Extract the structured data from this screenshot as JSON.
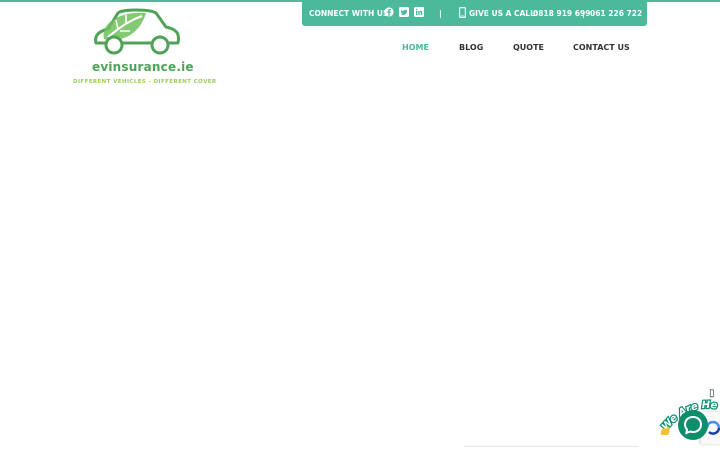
{
  "brand": {
    "name": "evinsurance.ie",
    "tagline": "DIFFERENT VEHICLES - DIFFERENT COVER",
    "primary_color": "#4bb99a",
    "logo_green": "#4fa356",
    "logo_lime": "#9ccb55"
  },
  "topbar": {
    "connect_label": "CONNECT WITH US:",
    "social_icons": [
      "facebook-icon",
      "twitter-icon",
      "linkedin-icon"
    ],
    "separator": "|",
    "call_label": "GIVE US A CALL:",
    "phone_1": "0818 919 699",
    "phone_separator": "|",
    "phone_2": "061 226 722"
  },
  "nav": {
    "home": "HOME",
    "blog": "BLOG",
    "quote": "QUOTE",
    "contact": "CONTACT US",
    "active": "HOME"
  },
  "chat": {
    "banner_text": "We Are Here!",
    "close_glyph": "▯",
    "bubble_color": "#0d8d6b"
  }
}
